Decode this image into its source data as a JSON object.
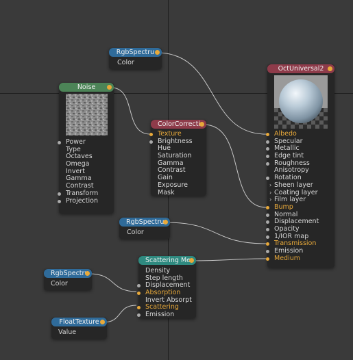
{
  "colors": {
    "background": "#3a3a3a",
    "node_body": "#262626",
    "header_blue": "#2f6b9a",
    "header_green": "#4c8457",
    "header_red": "#8e3b4a",
    "header_teal": "#2f8a80",
    "linked_pin": "#e8a93a",
    "wire": "#c8c8c8"
  },
  "nodes": {
    "rgb1": {
      "title": "RgbSpectru",
      "pins": [
        "Color"
      ]
    },
    "noise": {
      "title": "Noise",
      "pins": [
        "Power",
        "Type",
        "Octaves",
        "Omega",
        "Invert",
        "Gamma",
        "Contrast",
        "Transform",
        "Projection"
      ]
    },
    "colorcorrect": {
      "title": "ColorCorrecti",
      "pins": [
        "Texture",
        "Brightness",
        "Hue",
        "Saturation",
        "Gamma",
        "Contrast",
        "Gain",
        "Exposure",
        "Mask"
      ]
    },
    "universal": {
      "title": "OctUniversal2",
      "pins": [
        "Albedo",
        "Specular",
        "Metallic",
        "Edge tint",
        "Roughness",
        "Anisotropy",
        "Rotation",
        "Sheen layer",
        "Coating layer",
        "Film layer",
        "Bump",
        "Normal",
        "Displacement",
        "Opacity",
        "1/IOR map",
        "Transmission",
        "Emission",
        "Medium"
      ]
    },
    "rgb2": {
      "title": "RgbSpectru",
      "pins": [
        "Color"
      ]
    },
    "scattering": {
      "title": "Scattering Me",
      "pins": [
        "Density",
        "Step length",
        "Displacement",
        "Absorption",
        "Invert Absorpt",
        "Scattering",
        "Emission"
      ]
    },
    "rgb3": {
      "title": "RgbSpectru",
      "pins": [
        "Color"
      ]
    },
    "floattex": {
      "title": "FloatTexture",
      "pins": [
        "Value"
      ]
    }
  }
}
